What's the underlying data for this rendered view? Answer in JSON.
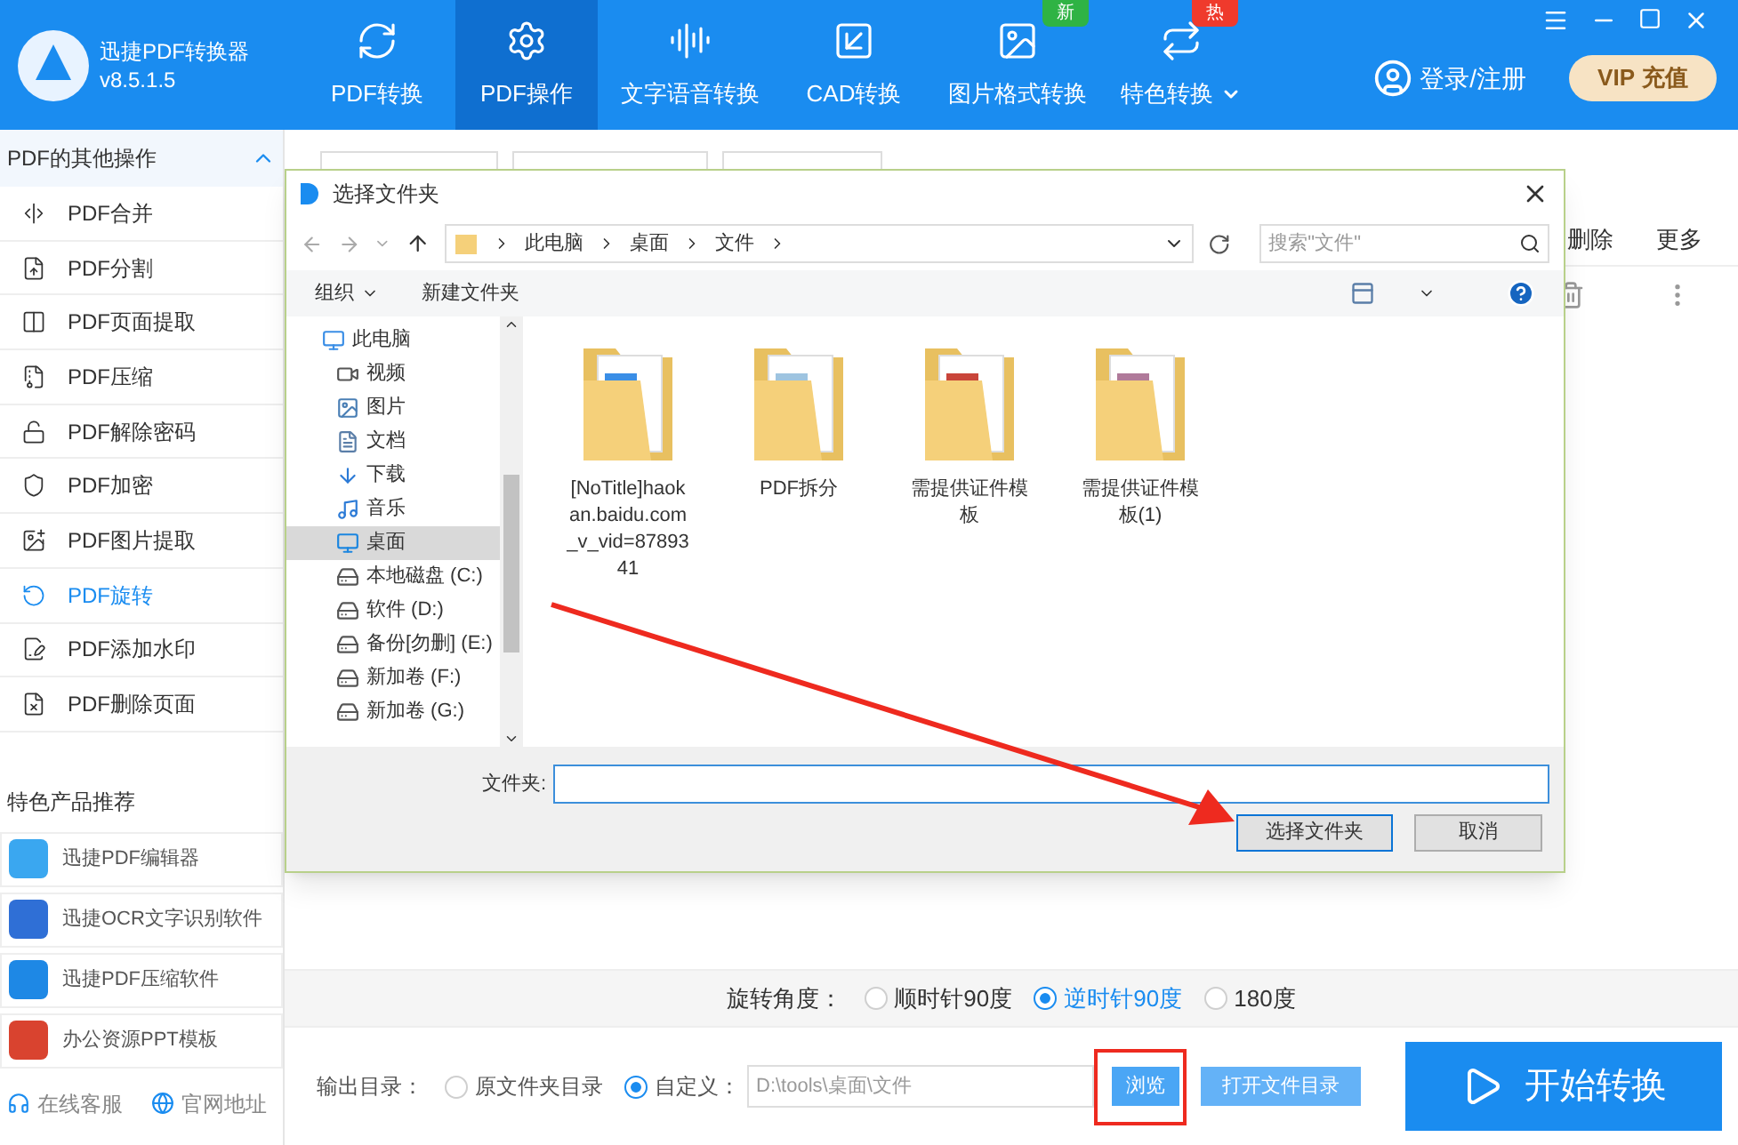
{
  "app": {
    "title": "迅捷PDF转换器",
    "version": "v8.5.1.5",
    "nav": [
      {
        "label": "PDF转换",
        "selected": false,
        "kind": "convert"
      },
      {
        "label": "PDF操作",
        "selected": true,
        "kind": "gear"
      },
      {
        "label": "文字语音转换",
        "selected": false,
        "kind": "audio"
      },
      {
        "label": "CAD转换",
        "selected": false,
        "kind": "cad"
      },
      {
        "label": "图片格式转换",
        "selected": false,
        "kind": "image",
        "badge": "新",
        "color": "#2fb344"
      },
      {
        "label": "特色转换",
        "selected": false,
        "kind": "special",
        "badge": "热",
        "color": "#ef3a2c",
        "dropdown": true
      }
    ],
    "login": "登录/注册",
    "vip": "VIP",
    "vip_text": "充值"
  },
  "sidebar": {
    "title": "PDF的其他操作",
    "expanded": true,
    "items": [
      {
        "label": "PDF合并",
        "selected": false,
        "kind": "merge"
      },
      {
        "label": "PDF分割",
        "selected": false,
        "kind": "split"
      },
      {
        "label": "PDF页面提取",
        "selected": false,
        "kind": "pages"
      },
      {
        "label": "PDF压缩",
        "selected": false,
        "kind": "compress"
      },
      {
        "label": "PDF解除密码",
        "selected": false,
        "kind": "unlock"
      },
      {
        "label": "PDF加密",
        "selected": false,
        "kind": "shield"
      },
      {
        "label": "PDF图片提取",
        "selected": false,
        "kind": "image"
      },
      {
        "label": "PDF旋转",
        "selected": true,
        "kind": "rotate"
      },
      {
        "label": "PDF添加水印",
        "selected": false,
        "kind": "watermark"
      },
      {
        "label": "PDF删除页面",
        "selected": false,
        "kind": "delete"
      }
    ],
    "products_title": "特色产品推荐",
    "products": [
      {
        "label": "迅捷PDF编辑器",
        "kind": "editor"
      },
      {
        "label": "迅捷OCR文字识别软件",
        "kind": "ocr"
      },
      {
        "label": "迅捷PDF压缩软件",
        "kind": "zip"
      },
      {
        "label": "办公资源PPT模板",
        "kind": "ppt"
      }
    ],
    "footer": [
      {
        "label": "在线客服",
        "kind": "service"
      },
      {
        "label": "官网地址",
        "kind": "web"
      }
    ]
  },
  "main": {
    "columns": [
      "删除",
      "更多"
    ],
    "rotation_label": "旋转角度：",
    "rotation_options": [
      {
        "label": "顺时针90度",
        "selected": false
      },
      {
        "label": "逆时针90度",
        "selected": true
      },
      {
        "label": "180度",
        "selected": false
      }
    ],
    "output_label": "输出目录：",
    "output_options": [
      {
        "label": "原文件夹目录",
        "selected": false
      },
      {
        "label": "自定义：",
        "selected": true
      }
    ],
    "output_path": "D:\\tools\\桌面\\文件",
    "browse": "浏览",
    "open_folder": "打开文件目录",
    "start": "开始转换"
  },
  "dialog": {
    "title": "选择文件夹",
    "breadcrumb": [
      "此电脑",
      "桌面",
      "文件"
    ],
    "search_placeholder": "搜索\"文件\"",
    "organize": "组织",
    "new_folder": "新建文件夹",
    "tree": [
      {
        "label": "此电脑",
        "kind": "pc",
        "selected": false
      },
      {
        "label": "视频",
        "kind": "video",
        "selected": false
      },
      {
        "label": "图片",
        "kind": "pictures",
        "selected": false
      },
      {
        "label": "文档",
        "kind": "docs",
        "selected": false
      },
      {
        "label": "下载",
        "kind": "download",
        "selected": false
      },
      {
        "label": "音乐",
        "kind": "music",
        "selected": false
      },
      {
        "label": "桌面",
        "kind": "desktop",
        "selected": true
      },
      {
        "label": "本地磁盘 (C:)",
        "kind": "drive",
        "selected": false
      },
      {
        "label": "软件 (D:)",
        "kind": "drive",
        "selected": false
      },
      {
        "label": "备份[勿删] (E:)",
        "kind": "drive",
        "selected": false
      },
      {
        "label": "新加卷 (F:)",
        "kind": "drive",
        "selected": false
      },
      {
        "label": "新加卷 (G:)",
        "kind": "drive",
        "selected": false
      }
    ],
    "files": [
      {
        "name": "[NoTitle]haokan.baidu.com_v_vid=8789341"
      },
      {
        "name": "PDF拆分"
      },
      {
        "name": "需提供证件模板"
      },
      {
        "name": "需提供证件模板(1)"
      }
    ],
    "folder_label": "文件夹:",
    "buttons": [
      {
        "label": "选择文件夹",
        "kind": "primary"
      },
      {
        "label": "取消",
        "kind": "normal"
      }
    ]
  }
}
